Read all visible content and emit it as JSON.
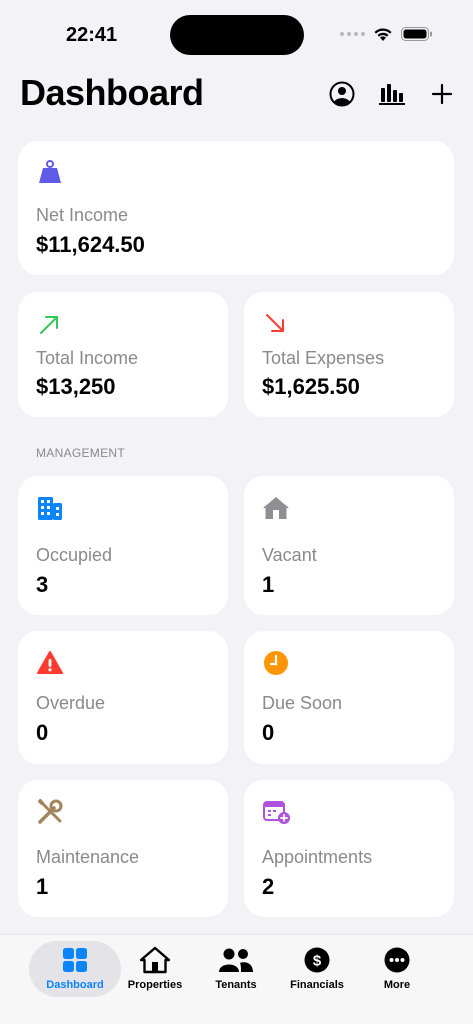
{
  "status": {
    "time": "22:41"
  },
  "header": {
    "title": "Dashboard"
  },
  "net_income": {
    "label": "Net Income",
    "value": "$11,624.50"
  },
  "total_income": {
    "label": "Total Income",
    "value": "$13,250"
  },
  "total_expenses": {
    "label": "Total Expenses",
    "value": "$1,625.50"
  },
  "management": {
    "section_label": "MANAGEMENT",
    "occupied": {
      "label": "Occupied",
      "value": "3"
    },
    "vacant": {
      "label": "Vacant",
      "value": "1"
    },
    "overdue": {
      "label": "Overdue",
      "value": "0"
    },
    "due_soon": {
      "label": "Due Soon",
      "value": "0"
    },
    "maintenance": {
      "label": "Maintenance",
      "value": "1"
    },
    "appointments": {
      "label": "Appointments",
      "value": "2"
    }
  },
  "tabs": [
    {
      "label": "Dashboard",
      "icon": "grid-icon"
    },
    {
      "label": "Properties",
      "icon": "house-icon"
    },
    {
      "label": "Tenants",
      "icon": "people-icon"
    },
    {
      "label": "Financials",
      "icon": "dollar-icon"
    },
    {
      "label": "More",
      "icon": "ellipsis-icon"
    }
  ],
  "colors": {
    "accent": "#0a84ff",
    "income": "#34c759",
    "expense": "#ff3b30",
    "net_income_icon": "#5e5ce6",
    "overdue": "#ff3b30",
    "due_soon": "#ff9500",
    "appointments": "#af52de"
  }
}
